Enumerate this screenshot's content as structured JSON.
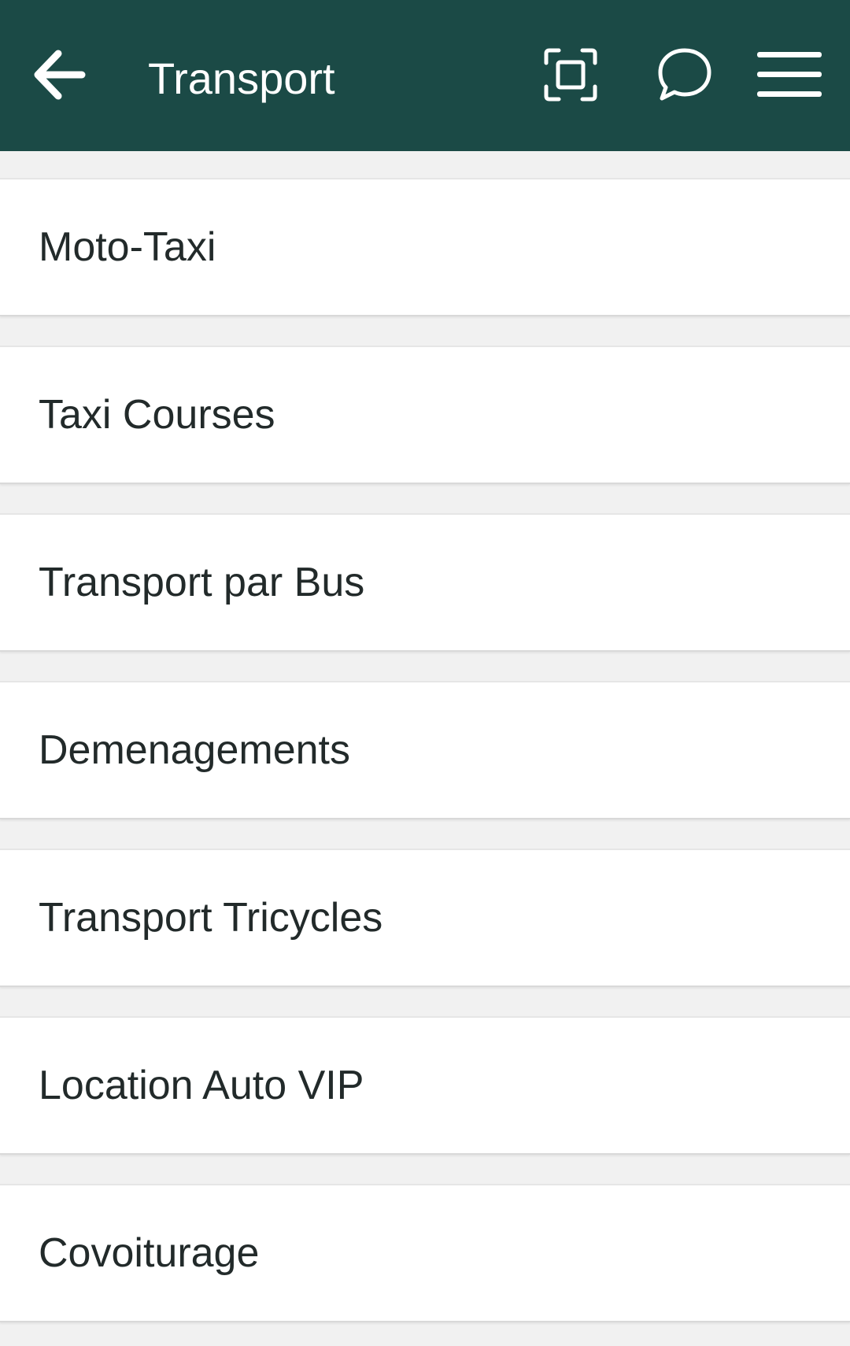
{
  "header": {
    "title": "Transport",
    "background_color": "#1b4a46",
    "icons": {
      "back": "arrow-left-icon",
      "scan": "scan-icon",
      "chat": "chat-bubble-icon",
      "menu": "hamburger-menu-icon"
    }
  },
  "list": {
    "items": [
      {
        "label": "Moto-Taxi"
      },
      {
        "label": "Taxi Courses"
      },
      {
        "label": "Transport par Bus"
      },
      {
        "label": "Demenagements"
      },
      {
        "label": "Transport Tricycles"
      },
      {
        "label": "Location Auto VIP"
      },
      {
        "label": "Covoiturage"
      }
    ]
  }
}
